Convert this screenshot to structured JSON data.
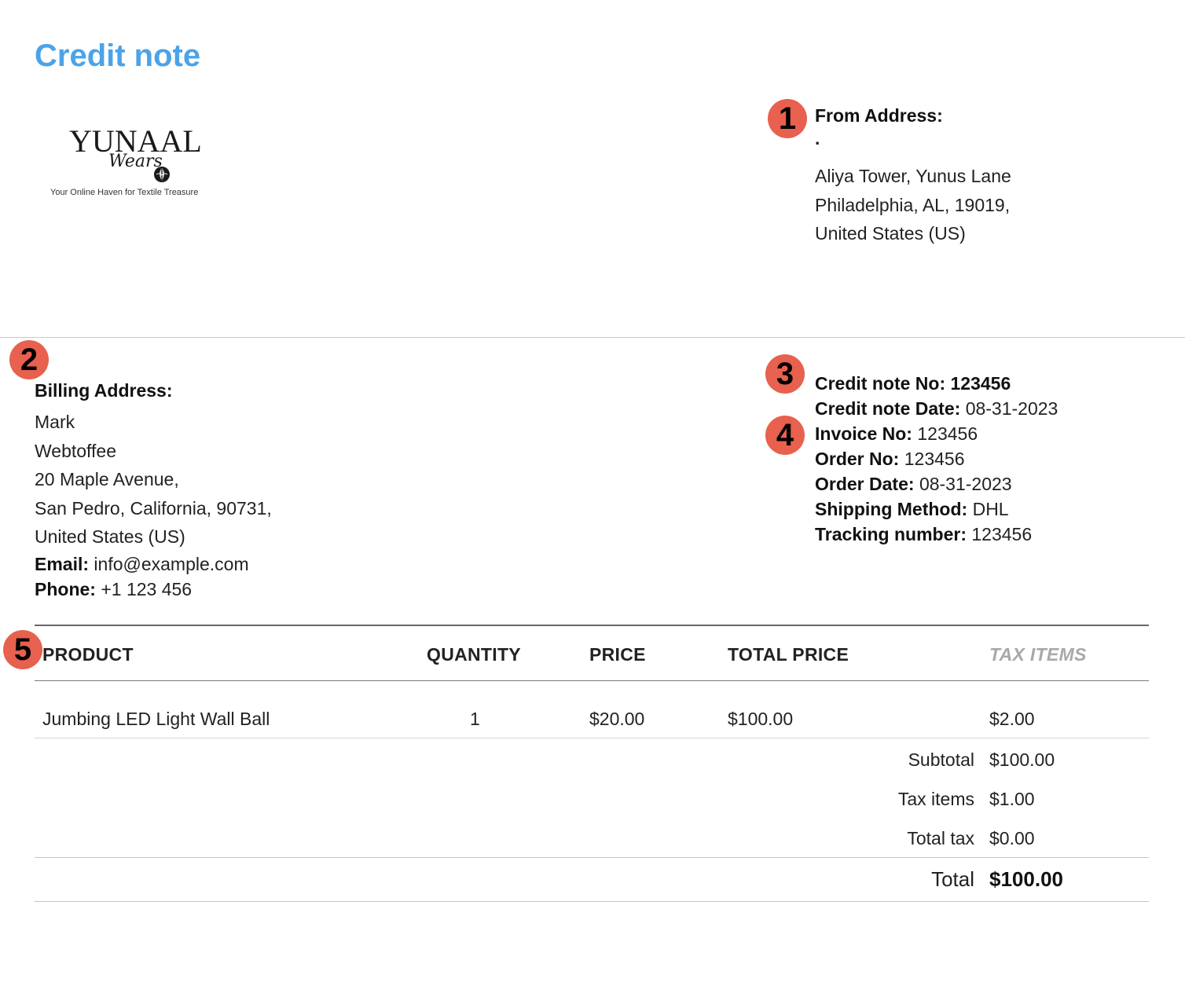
{
  "document": {
    "title": "Credit note"
  },
  "logo": {
    "brand": "YUNAAL",
    "script": "Wears",
    "tagline": "Your Online Haven for Textile Treasure"
  },
  "markers": [
    "1",
    "2",
    "3",
    "4",
    "5"
  ],
  "from_address": {
    "heading": "From Address:",
    "name": ".",
    "lines": [
      "Aliya Tower, Yunus Lane",
      "Philadelphia, AL, 19019,",
      "United States (US)"
    ]
  },
  "billing_address": {
    "heading": "Billing Address:",
    "lines": [
      "Mark",
      "Webtoffee",
      "20 Maple Avenue,",
      "San Pedro, California, 90731,",
      "United States (US)"
    ],
    "email_label": "Email:",
    "email_value": "info@example.com",
    "phone_label": "Phone:",
    "phone_value": "+1 123 456"
  },
  "meta": {
    "credit_note_no_label": "Credit note No:",
    "credit_note_no_value": "123456",
    "credit_note_date_label": "Credit note Date:",
    "credit_note_date_value": "08-31-2023",
    "invoice_no_label": "Invoice No:",
    "invoice_no_value": "123456",
    "order_no_label": "Order No:",
    "order_no_value": "123456",
    "order_date_label": "Order Date:",
    "order_date_value": "08-31-2023",
    "shipping_method_label": "Shipping Method:",
    "shipping_method_value": "DHL",
    "tracking_label": "Tracking number:",
    "tracking_value": "123456"
  },
  "table": {
    "headers": {
      "product": "PRODUCT",
      "quantity": "QUANTITY",
      "price": "PRICE",
      "total_price": "TOTAL PRICE",
      "tax_items": "TAX ITEMS"
    },
    "rows": [
      {
        "product": "Jumbing LED Light Wall Ball",
        "quantity": "1",
        "price": "$20.00",
        "total_price": "$100.00",
        "tax_items": "$2.00"
      }
    ]
  },
  "summary": {
    "subtotal_label": "Subtotal",
    "subtotal_value": "$100.00",
    "tax_items_label": "Tax items",
    "tax_items_value": "$1.00",
    "total_tax_label": "Total tax",
    "total_tax_value": "$0.00",
    "total_label": "Total",
    "total_value": "$100.00"
  },
  "colors": {
    "title": "#4ba3e8",
    "marker": "#e8604e",
    "tax_header": "#a8a8a8"
  }
}
